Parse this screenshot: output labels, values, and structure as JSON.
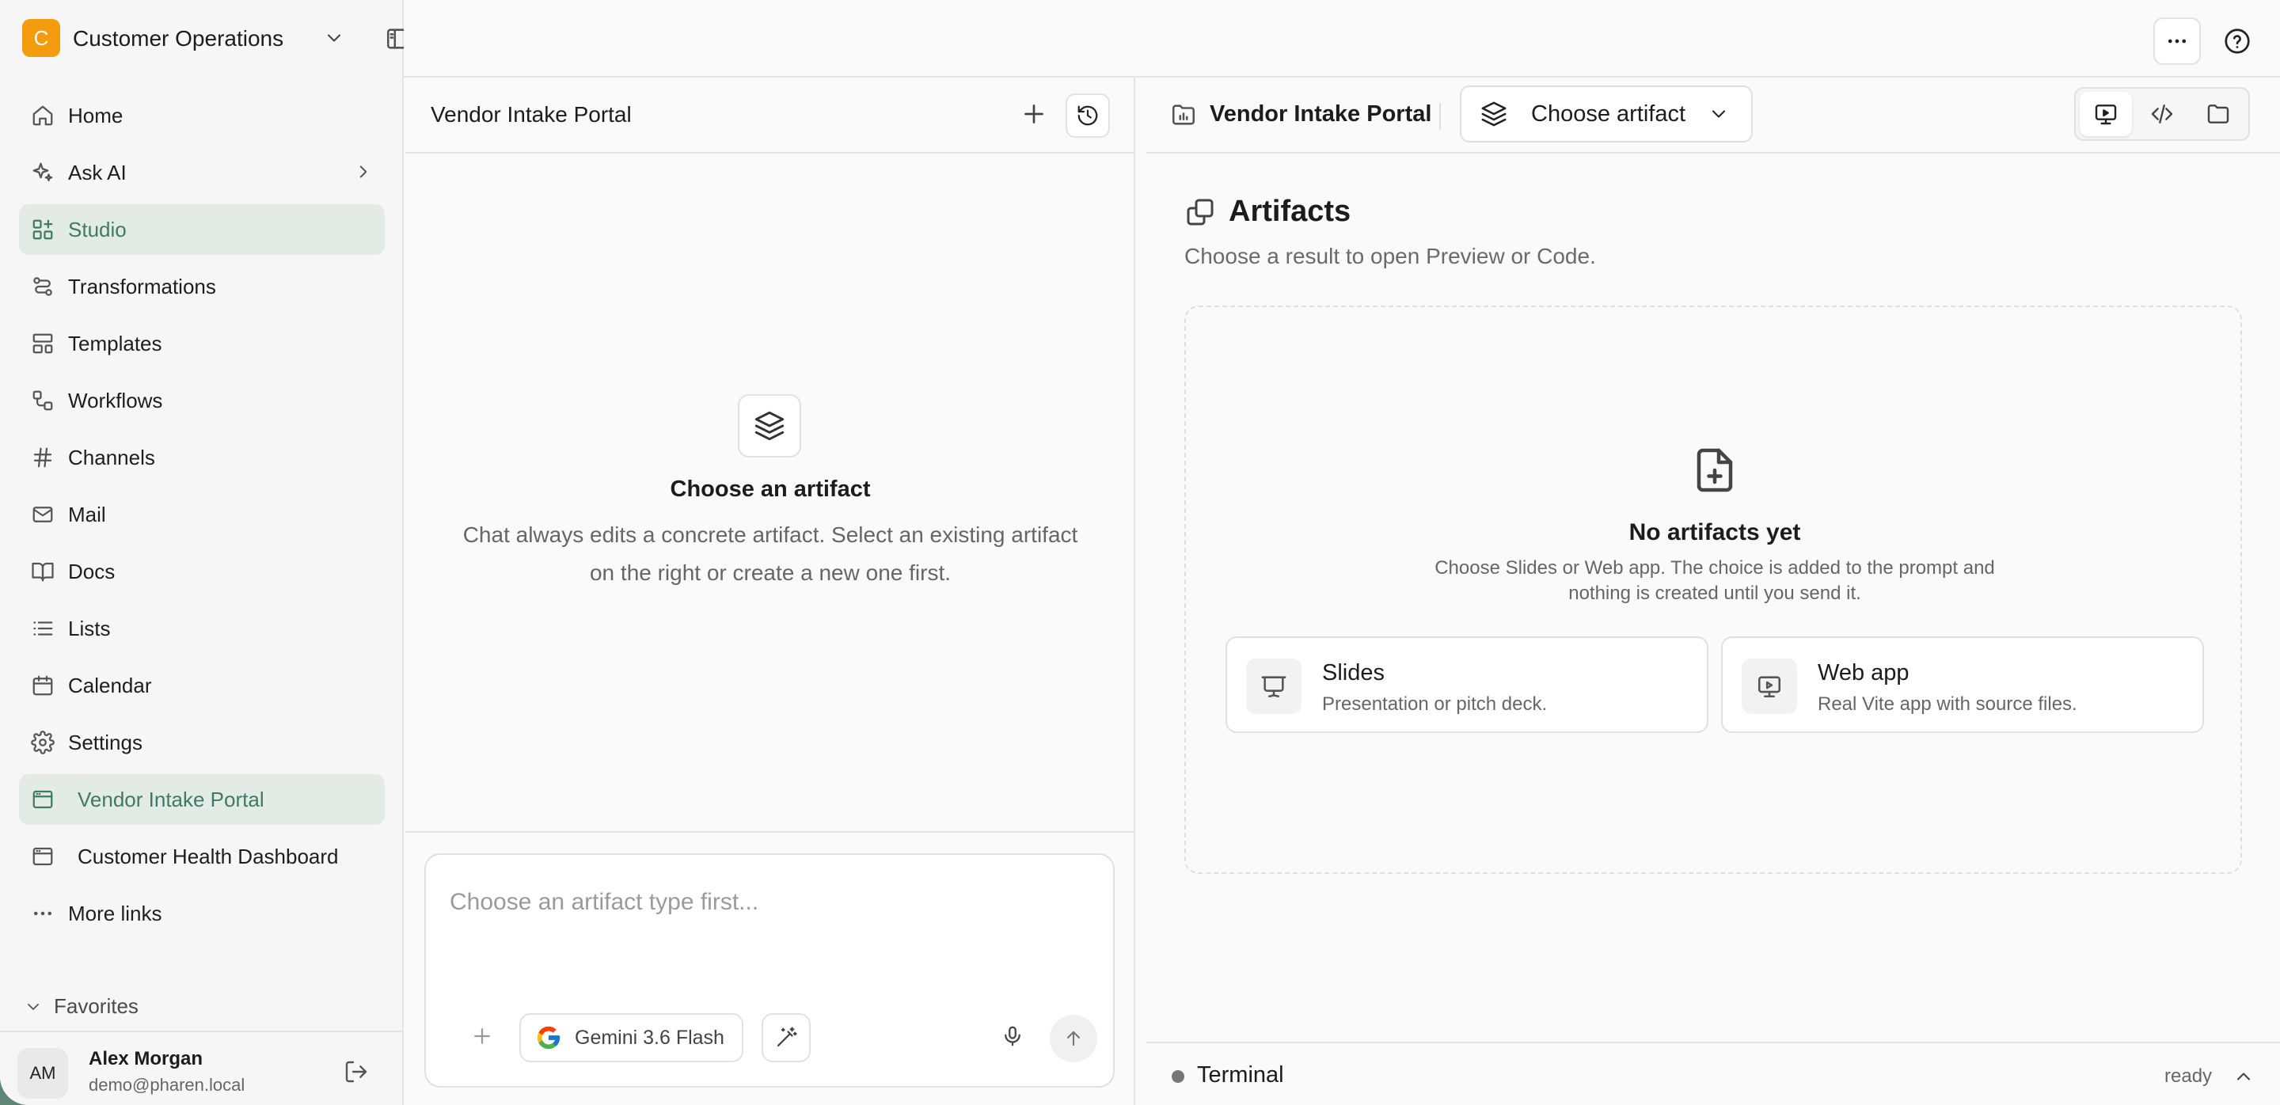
{
  "workspace": {
    "avatar_letter": "C",
    "name": "Customer Operations",
    "accent_color": "#f29c0e"
  },
  "sidebar": {
    "items": [
      {
        "label": "Home",
        "icon": "home-icon"
      },
      {
        "label": "Ask AI",
        "icon": "sparkles-icon"
      },
      {
        "label": "Studio",
        "icon": "grid-plus-icon",
        "active": true
      },
      {
        "label": "Transformations",
        "icon": "route-icon"
      },
      {
        "label": "Templates",
        "icon": "layout-icon"
      },
      {
        "label": "Workflows",
        "icon": "workflow-icon"
      },
      {
        "label": "Channels",
        "icon": "hash-icon"
      },
      {
        "label": "Mail",
        "icon": "mail-icon"
      },
      {
        "label": "Docs",
        "icon": "book-icon"
      },
      {
        "label": "Lists",
        "icon": "list-icon"
      },
      {
        "label": "Calendar",
        "icon": "calendar-icon"
      },
      {
        "label": "Settings",
        "icon": "gear-icon"
      },
      {
        "label": "Vendor Intake Portal",
        "icon": "browser-window-icon",
        "active": true
      },
      {
        "label": "Customer Health Dashboard",
        "icon": "browser-window-icon"
      },
      {
        "label": "More links",
        "icon": "more-horizontal-icon"
      }
    ],
    "favorites_label": "Favorites",
    "active_color": "#3f7a62"
  },
  "user": {
    "initials": "AM",
    "name": "Alex Morgan",
    "email": "demo@pharen.local"
  },
  "chat": {
    "title": "Vendor Intake Portal",
    "empty_title": "Choose an artifact",
    "empty_desc_line1": "Chat always edits a concrete artifact. Select an existing artifact",
    "empty_desc_line2": "on the right or create a new one first.",
    "input_placeholder": "Choose an artifact type first...",
    "model_label": "Gemini 3.6 Flash"
  },
  "artifact_panel": {
    "title": "Vendor Intake Portal",
    "choose_label": "Choose artifact",
    "heading": "Artifacts",
    "subheading": "Choose a result to open Preview or Code.",
    "empty_title": "No artifacts yet",
    "empty_desc_line1": "Choose Slides or Web app. The choice is added to the prompt and",
    "empty_desc_line2": "nothing is created until you send it.",
    "types": [
      {
        "title": "Slides",
        "desc": "Presentation or pitch deck.",
        "icon": "presentation-icon"
      },
      {
        "title": "Web app",
        "desc": "Real Vite app with source files.",
        "icon": "monitor-play-icon"
      }
    ],
    "view_modes": [
      "preview-icon",
      "code-icon",
      "folder-icon"
    ]
  },
  "terminal": {
    "label": "Terminal",
    "status": "ready"
  }
}
